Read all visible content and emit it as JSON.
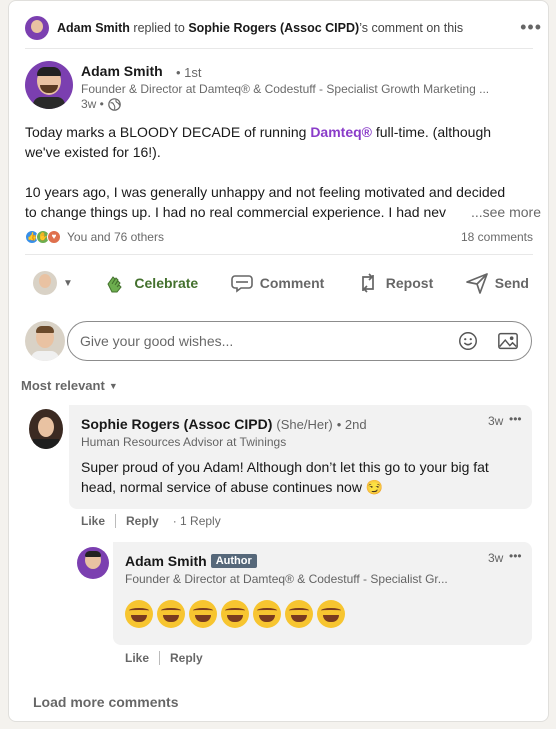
{
  "header": {
    "actor": "Adam Smith",
    "verb": " replied to ",
    "target": "Sophie Rogers (Assoc CIPD)",
    "suffix": "’s comment on this",
    "more_icon": "more-horizontal-icon"
  },
  "post": {
    "author_name": "Adam Smith",
    "degree": "• 1st",
    "headline": "Founder & Director at Damteq® & Codestuff - Specialist Growth Marketing ...",
    "time": "3w •",
    "visibility_icon": "globe-icon",
    "text_line1_a": "Today marks a BLOODY DECADE of running ",
    "text_line1_brand": "Damteq®",
    "text_line1_b": " full-time. (although",
    "text_line2": "we've existed for 16!).",
    "text_line3": "10 years ago, I was generally unhappy and not feeling motivated and decided",
    "text_line4": "to change things up. I had no real commercial experience. I had nev",
    "see_more": "...see more",
    "reactions_text": "You and 76 others",
    "comments_count": "18 comments"
  },
  "actions": {
    "celebrate": "Celebrate",
    "comment": "Comment",
    "repost": "Repost",
    "send": "Send"
  },
  "composer": {
    "placeholder": "Give your good wishes..."
  },
  "sort": {
    "label": "Most relevant"
  },
  "comments": [
    {
      "name": "Sophie Rogers (Assoc CIPD)",
      "pronouns": "(She/Her)",
      "degree": "• 2nd",
      "headline": "Human Resources Advisor at Twinings",
      "time": "3w",
      "text": "Super proud of you Adam! Although don’t let this go to your big fat head, normal service of abuse continues now 😏",
      "like": "Like",
      "reply": "Reply",
      "replies": "· 1 Reply"
    },
    {
      "name": "Adam Smith",
      "badge": "Author",
      "headline": "Founder & Director at Damteq® & Codestuff - Specialist Gr...",
      "time": "3w",
      "emoji_count": 7,
      "like": "Like",
      "reply": "Reply"
    }
  ],
  "load_more": "Load more comments",
  "colors": {
    "brand_purple": "#8a3cc9",
    "celebrate_green": "#44712e",
    "author_badge": "#56687a"
  }
}
